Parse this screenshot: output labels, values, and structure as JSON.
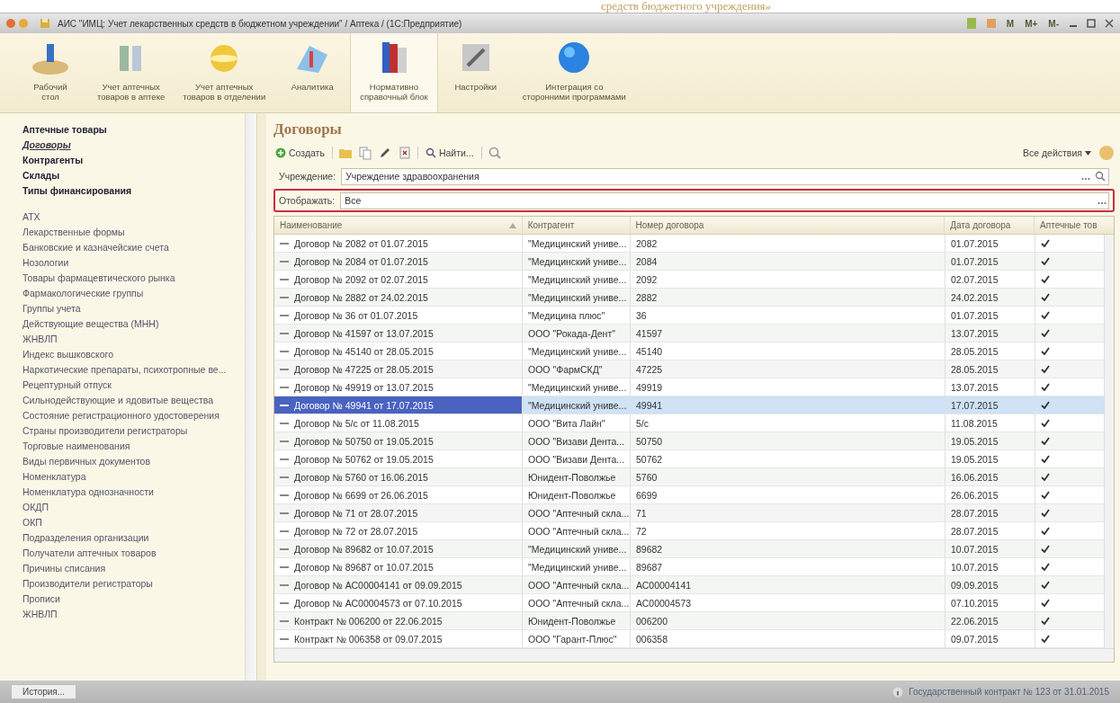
{
  "caption": "средств бюджетного учреждения»",
  "window": {
    "title": "АИС \"ИМЦ: Учет лекарственных средств в бюджетном учреждении\" / Аптека /  (1С:Предприятие)",
    "memory_buttons": [
      "M",
      "M+",
      "M-"
    ]
  },
  "sections": [
    {
      "label": "Рабочий\nстол",
      "selected": false
    },
    {
      "label": "Учет аптечных\nтоваров в аптеке",
      "selected": false
    },
    {
      "label": "Учет аптечных\nтоваров в отделении",
      "selected": false
    },
    {
      "label": "Аналитика",
      "selected": false
    },
    {
      "label": "Нормативно\nсправочный блок",
      "selected": true
    },
    {
      "label": "Настройки",
      "selected": false
    },
    {
      "label": "Интеграция со\nсторонними программами",
      "selected": false
    }
  ],
  "sidebar": {
    "main_items": [
      {
        "label": "Аптечные товары",
        "selected": false
      },
      {
        "label": "Договоры",
        "selected": true
      },
      {
        "label": "Контрагенты",
        "selected": false
      },
      {
        "label": "Склады",
        "selected": false
      },
      {
        "label": "Типы финансирования",
        "selected": false
      }
    ],
    "items": [
      "АТХ",
      "Лекарственные формы",
      "Банковские и казначейские счета",
      "Нозологии",
      "Товары фармацевтического рынка",
      "Фармакологические группы",
      "Группы учета",
      "Действующие вещества (МНН)",
      "ЖНВЛП",
      "Индекс вышковского",
      "Наркотические препараты, психотропные ве...",
      "Рецептурный отпуск",
      "Сильнодействующие и ядовитые вещества",
      "Состояние регистрационного удостоверения",
      "Страны производители регистраторы",
      "Торговые наименования",
      "Виды первичных документов",
      "Номенклатура",
      "Номенклатура однозначности",
      "ОКДП",
      "ОКП",
      "Подразделения организации",
      "Получатели аптечных товаров",
      "Причины списания",
      "Производители регистраторы",
      "Прописи",
      "ЖНВЛП"
    ]
  },
  "form": {
    "title": "Договоры",
    "toolbar": {
      "create": "Создать",
      "find": "Найти...",
      "all_actions": "Все действия"
    },
    "fields": [
      {
        "label": "Учреждение:",
        "value": "Учреждение здравоохранения",
        "highlighted": false
      },
      {
        "label": "Отображать:",
        "value": "Все",
        "highlighted": true
      }
    ],
    "table": {
      "columns": [
        "Наименование",
        "Контрагент",
        "Номер договора",
        "Дата договора",
        "Аптечные тов"
      ],
      "rows": [
        {
          "name": "Договор № 2082 от 01.07.2015",
          "counterparty": "\"Медицинский униве...",
          "number": "2082",
          "date": "01.07.2015",
          "checked": true,
          "selected": false
        },
        {
          "name": "Договор № 2084 от 01.07.2015",
          "counterparty": "\"Медицинский униве...",
          "number": "2084",
          "date": "01.07.2015",
          "checked": true,
          "selected": false
        },
        {
          "name": "Договор № 2092 от 02.07.2015",
          "counterparty": "\"Медицинский униве...",
          "number": "2092",
          "date": "02.07.2015",
          "checked": true,
          "selected": false
        },
        {
          "name": "Договор № 2882 от 24.02.2015",
          "counterparty": "\"Медицинский униве...",
          "number": "2882",
          "date": "24.02.2015",
          "checked": true,
          "selected": false
        },
        {
          "name": "Договор № 36 от 01.07.2015",
          "counterparty": "\"Медицина плюс\"",
          "number": "36",
          "date": "01.07.2015",
          "checked": true,
          "selected": false
        },
        {
          "name": "Договор № 41597 от 13.07.2015",
          "counterparty": "ООО \"Рокада-Дент\"",
          "number": "41597",
          "date": "13.07.2015",
          "checked": true,
          "selected": false
        },
        {
          "name": "Договор № 45140 от 28.05.2015",
          "counterparty": "\"Медицинский униве...",
          "number": "45140",
          "date": "28.05.2015",
          "checked": true,
          "selected": false
        },
        {
          "name": "Договор № 47225 от 28.05.2015",
          "counterparty": "ООО \"ФармСКД\"",
          "number": "47225",
          "date": "28.05.2015",
          "checked": true,
          "selected": false
        },
        {
          "name": "Договор № 49919 от 13.07.2015",
          "counterparty": "\"Медицинский униве...",
          "number": "49919",
          "date": "13.07.2015",
          "checked": true,
          "selected": false
        },
        {
          "name": "Договор № 49941 от 17.07.2015",
          "counterparty": "\"Медицинский униве...",
          "number": "49941",
          "date": "17.07.2015",
          "checked": true,
          "selected": true
        },
        {
          "name": "Договор № 5/с от 11.08.2015",
          "counterparty": "ООО \"Вита Лайн\"",
          "number": "5/с",
          "date": "11.08.2015",
          "checked": true,
          "selected": false
        },
        {
          "name": "Договор № 50750 от 19.05.2015",
          "counterparty": "ООО \"Визави Дента...",
          "number": "50750",
          "date": "19.05.2015",
          "checked": true,
          "selected": false
        },
        {
          "name": "Договор № 50762 от 19.05.2015",
          "counterparty": "ООО \"Визави Дента...",
          "number": "50762",
          "date": "19.05.2015",
          "checked": true,
          "selected": false
        },
        {
          "name": "Договор № 5760 от 16.06.2015",
          "counterparty": "Юнидент-Поволжье",
          "number": "5760",
          "date": "16.06.2015",
          "checked": true,
          "selected": false
        },
        {
          "name": "Договор № 6699 от 26.06.2015",
          "counterparty": "Юнидент-Поволжье",
          "number": "6699",
          "date": "26.06.2015",
          "checked": true,
          "selected": false
        },
        {
          "name": "Договор № 71 от 28.07.2015",
          "counterparty": "ООО \"Аптечный скла...",
          "number": "71",
          "date": "28.07.2015",
          "checked": true,
          "selected": false
        },
        {
          "name": "Договор № 72 от 28.07.2015",
          "counterparty": "ООО \"Аптечный скла...",
          "number": "72",
          "date": "28.07.2015",
          "checked": true,
          "selected": false
        },
        {
          "name": "Договор № 89682 от 10.07.2015",
          "counterparty": "\"Медицинский униве...",
          "number": "89682",
          "date": "10.07.2015",
          "checked": true,
          "selected": false
        },
        {
          "name": "Договор № 89687 от 10.07.2015",
          "counterparty": "\"Медицинский униве...",
          "number": "89687",
          "date": "10.07.2015",
          "checked": true,
          "selected": false
        },
        {
          "name": "Договор № АС00004141 от 09.09.2015",
          "counterparty": "ООО \"Аптечный скла...",
          "number": "АС00004141",
          "date": "09.09.2015",
          "checked": true,
          "selected": false
        },
        {
          "name": "Договор № АС00004573 от 07.10.2015",
          "counterparty": "ООО \"Аптечный скла...",
          "number": "АС00004573",
          "date": "07.10.2015",
          "checked": true,
          "selected": false
        },
        {
          "name": "Контракт № 006200 от 22.06.2015",
          "counterparty": "Юнидент-Поволжье",
          "number": "006200",
          "date": "22.06.2015",
          "checked": true,
          "selected": false
        },
        {
          "name": "Контракт № 006358 от 09.07.2015",
          "counterparty": "ООО \"Гарант-Плюс\"",
          "number": "006358",
          "date": "09.07.2015",
          "checked": true,
          "selected": false
        }
      ]
    }
  },
  "status_bar": {
    "history_button": "История...",
    "contract": "Государственный контракт № 123 от 31.01.2015"
  }
}
